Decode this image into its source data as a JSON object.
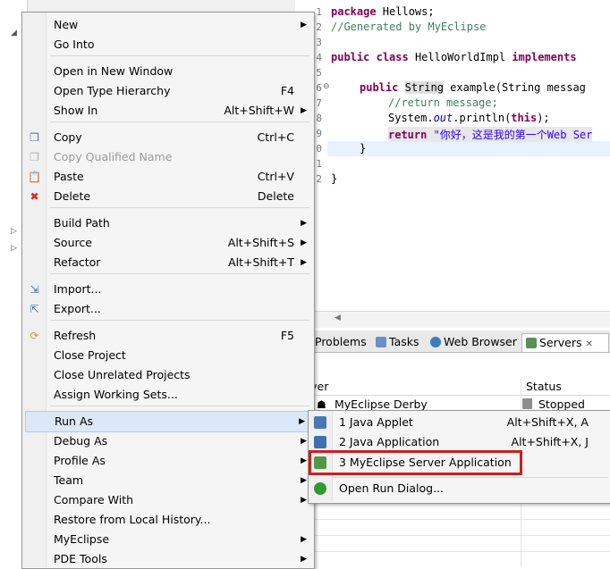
{
  "editor": {
    "line_numbers": [
      "1",
      "2",
      "3",
      "4",
      "5",
      "6",
      "7",
      "8",
      "9",
      "0",
      "1",
      "2"
    ],
    "code": {
      "l1_kw": "package",
      "l1_rest": " Hellows;",
      "l2_comment": "//Generated by MyEclipse",
      "l4_kw1": "public",
      "l4_kw2": "class",
      "l4_name": " HelloWorldImpl ",
      "l4_kw3": "implements",
      "l6_kw": "public",
      "l6_type": "String",
      "l6_rest": " example(String messag",
      "l7_comment": "//return message;",
      "l8_pre": "System.",
      "l8_field": "out",
      "l8_post": ".println(",
      "l8_kw": "this",
      "l8_end": ");",
      "l9_kw": "return",
      "l9_str": " \"你好，这是我的第一个Web Ser",
      "l10": "}",
      "l12": "}"
    }
  },
  "views": {
    "tabs": [
      "Problems",
      "Tasks",
      "Web Browser",
      "Servers"
    ],
    "active_tab": "Servers",
    "close_glyph": "✕",
    "columns": [
      "rver",
      "Status"
    ],
    "row": {
      "server": "MyEclipse Derby",
      "status": "Stopped"
    }
  },
  "context_menu": {
    "items": [
      {
        "label": "New",
        "shortcut": "",
        "submenu": true
      },
      {
        "label": "Go Into",
        "shortcut": "",
        "submenu": false
      },
      {
        "label": "Open in New Window",
        "shortcut": "",
        "submenu": false
      },
      {
        "label": "Open Type Hierarchy",
        "shortcut": "F4",
        "submenu": false
      },
      {
        "label": "Show In",
        "shortcut": "Alt+Shift+W",
        "submenu": true
      },
      {
        "label": "Copy",
        "shortcut": "Ctrl+C",
        "submenu": false
      },
      {
        "label": "Copy Qualified Name",
        "shortcut": "",
        "submenu": false,
        "disabled": true
      },
      {
        "label": "Paste",
        "shortcut": "Ctrl+V",
        "submenu": false
      },
      {
        "label": "Delete",
        "shortcut": "Delete",
        "submenu": false
      },
      {
        "label": "Build Path",
        "shortcut": "",
        "submenu": true
      },
      {
        "label": "Source",
        "shortcut": "Alt+Shift+S",
        "submenu": true
      },
      {
        "label": "Refactor",
        "shortcut": "Alt+Shift+T",
        "submenu": true
      },
      {
        "label": "Import...",
        "shortcut": "",
        "submenu": false
      },
      {
        "label": "Export...",
        "shortcut": "",
        "submenu": false
      },
      {
        "label": "Refresh",
        "shortcut": "F5",
        "submenu": false
      },
      {
        "label": "Close Project",
        "shortcut": "",
        "submenu": false
      },
      {
        "label": "Close Unrelated Projects",
        "shortcut": "",
        "submenu": false
      },
      {
        "label": "Assign Working Sets...",
        "shortcut": "",
        "submenu": false
      },
      {
        "label": "Run As",
        "shortcut": "",
        "submenu": true,
        "highlighted": true
      },
      {
        "label": "Debug As",
        "shortcut": "",
        "submenu": true
      },
      {
        "label": "Profile As",
        "shortcut": "",
        "submenu": true
      },
      {
        "label": "Team",
        "shortcut": "",
        "submenu": true
      },
      {
        "label": "Compare With",
        "shortcut": "",
        "submenu": true
      },
      {
        "label": "Restore from Local History...",
        "shortcut": "",
        "submenu": false
      },
      {
        "label": "MyEclipse",
        "shortcut": "",
        "submenu": true
      },
      {
        "label": "PDE Tools",
        "shortcut": "",
        "submenu": true
      }
    ],
    "icons": {
      "Copy": "copy-icon",
      "Copy Qualified Name": "copy-icon",
      "Paste": "paste-icon",
      "Delete": "delete-icon",
      "Import...": "import-icon",
      "Export...": "export-icon",
      "Refresh": "refresh-icon"
    }
  },
  "submenu": {
    "items": [
      {
        "label": "1 Java Applet",
        "shortcut": "Alt+Shift+X, A",
        "icon": "java-applet-icon"
      },
      {
        "label": "2 Java Application",
        "shortcut": "Alt+Shift+X, J",
        "icon": "java-application-icon"
      },
      {
        "label": "3 MyEclipse Server Application",
        "shortcut": "",
        "icon": "server-application-icon",
        "annotated": true
      },
      {
        "label": "Open Run Dialog...",
        "shortcut": "",
        "icon": "run-icon"
      }
    ]
  },
  "colors": {
    "annotation_box": "#cc1f1f",
    "menu_highlight": "#dce8f7",
    "keyword": "#7f0055",
    "comment": "#3f7f5f",
    "string": "#2a00ff"
  }
}
